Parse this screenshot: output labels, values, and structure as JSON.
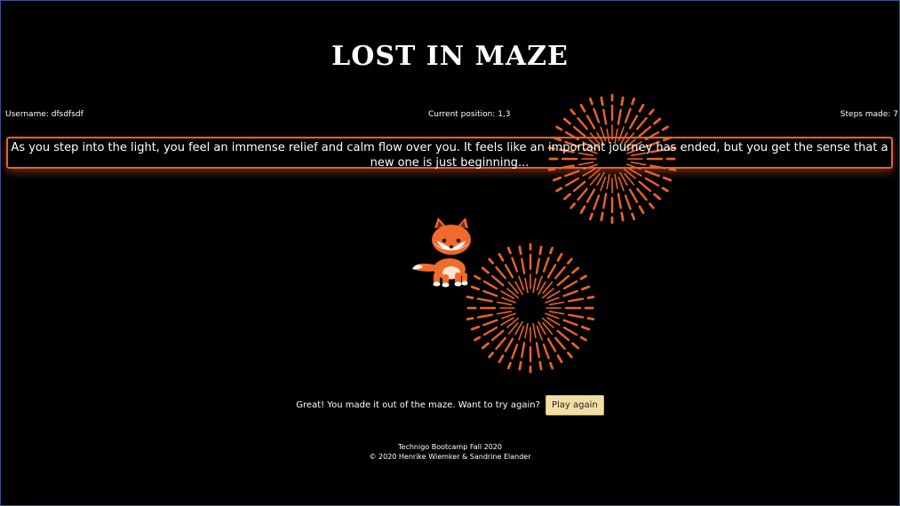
{
  "game": {
    "title": "LOST IN MAZE",
    "username_label": "Username: dfsdfsdf",
    "position_label": "Current position: 1,3",
    "steps_label": "Steps made: 7",
    "story_text": "As you step into the light, you feel an immense relief and calm flow over you. It feels like an important journey has ended, but you get the sense that a new one is just beginning...",
    "end_prompt": "Great! You made it out of the maze. Want to try again?",
    "play_again_label": "Play again"
  },
  "footer": {
    "line1": "Technigo Bootcamp Fall 2020",
    "line2": "© 2020 Henrike Wiemker & Sandrine Elander"
  },
  "colors": {
    "background": "#000000",
    "accent": "#e8622a",
    "button": "#f3dfa6"
  },
  "icons": {
    "character": "fox-icon",
    "celebration": "firework-icon"
  }
}
